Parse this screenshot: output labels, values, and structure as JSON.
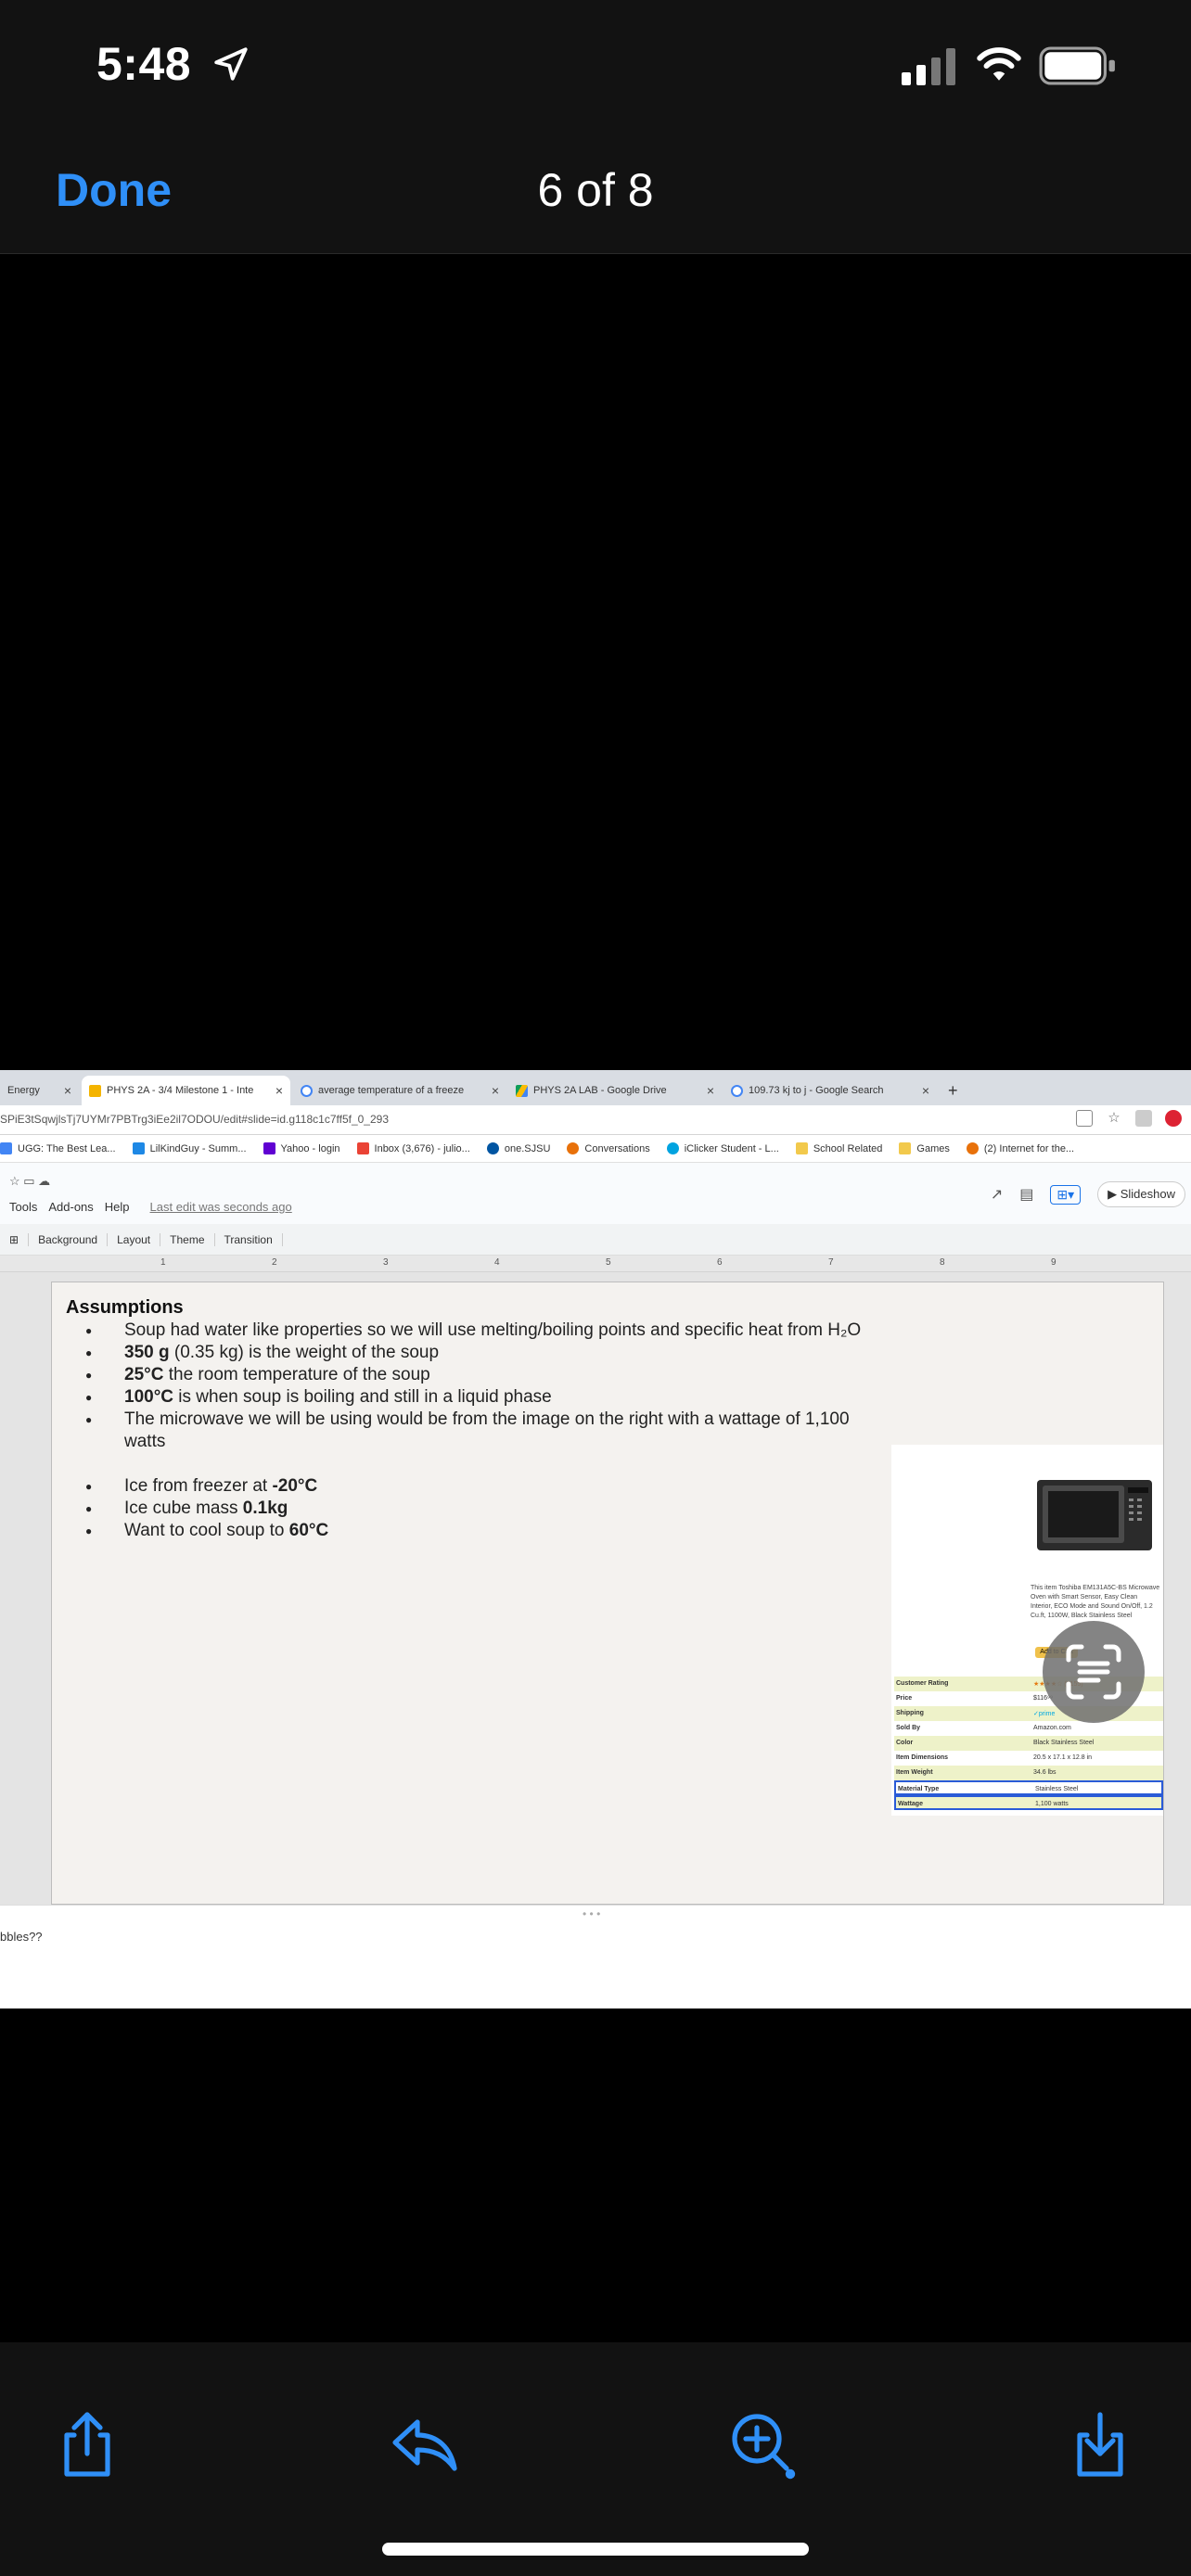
{
  "status_bar": {
    "time": "5:48"
  },
  "nav": {
    "done_label": "Done",
    "page_counter": "6 of 8"
  },
  "browser": {
    "tabs": [
      {
        "title": "Energy"
      },
      {
        "title": "PHYS 2A - 3/4 Milestone 1 - Inte"
      },
      {
        "title": "average temperature of a freeze"
      },
      {
        "title": "PHYS 2A LAB - Google Drive"
      },
      {
        "title": "109.73 kj to j - Google Search"
      }
    ],
    "url": "SPiE3tSqwjlsTj7UYMr7PBTrg3iEe2il7ODOU/edit#slide=id.g118c1c7ff5f_0_293",
    "bookmarks": [
      "UGG: The Best Lea...",
      "LilKindGuy - Summ...",
      "Yahoo - login",
      "Inbox (3,676) - julio...",
      "one.SJSU",
      "Conversations",
      "iClicker Student - L...",
      "School Related",
      "Games",
      "(2) Internet for the..."
    ]
  },
  "docs": {
    "menu": [
      "Tools",
      "Add-ons",
      "Help"
    ],
    "last_edit": "Last edit was seconds ago",
    "slideshow_label": "Slideshow",
    "toolbar": [
      "Background",
      "Layout",
      "Theme",
      "Transition"
    ],
    "ruler_ticks": [
      "1",
      "2",
      "3",
      "4",
      "5",
      "6",
      "7",
      "8",
      "9"
    ]
  },
  "slide": {
    "title": "Assumptions",
    "bullets": [
      {
        "bold": "",
        "text": "Soup had water like properties so we will use melting/boiling points and specific heat from H₂O",
        "suffix": ""
      },
      {
        "bold": "350 g",
        "text": " (0.35 kg) is the weight of the soup",
        "suffix": ""
      },
      {
        "bold": "25°C",
        "text": " the room temperature of the soup",
        "suffix": ""
      },
      {
        "bold": "100°C",
        "text": " is when soup is boiling and still in a liquid phase",
        "suffix": ""
      },
      {
        "bold": "",
        "text": "The microwave we will be using would be from the image on the right with a wattage of 1,100 watts",
        "suffix": ""
      }
    ],
    "bullets2": [
      {
        "text": " Ice from freezer at ",
        "bold": "-20°C"
      },
      {
        "text": " Ice cube mass ",
        "bold": "0.1kg"
      },
      {
        "text": "Want to cool soup to ",
        "bold": "60°C"
      }
    ],
    "product": {
      "description": "This item Toshiba EM131A5C-BS Microwave Oven with Smart Sensor, Easy Clean Interior, ECO Mode and Sound On/Off, 1.2 Cu.ft, 1100W, Black Stainless Steel",
      "cart_label": "Add to Cart",
      "rows": [
        {
          "k": "Customer Rating",
          "v": "★★★★☆ (8155)"
        },
        {
          "k": "Price",
          "v": "$116⁹⁹"
        },
        {
          "k": "Shipping",
          "v": "✓prime"
        },
        {
          "k": "Sold By",
          "v": "Amazon.com"
        },
        {
          "k": "Color",
          "v": "Black Stainless Steel"
        },
        {
          "k": "Item Dimensions",
          "v": "20.5 x 17.1 x 12.8 in"
        },
        {
          "k": "Item Weight",
          "v": "34.6 lbs"
        },
        {
          "k": "Material Type",
          "v": "Stainless Steel"
        },
        {
          "k": "Wattage",
          "v": "1,100 watts"
        }
      ]
    }
  },
  "speaker_notes": "bbles??",
  "colors": {
    "accent": "#2f8ff7",
    "bar": "#121212"
  }
}
